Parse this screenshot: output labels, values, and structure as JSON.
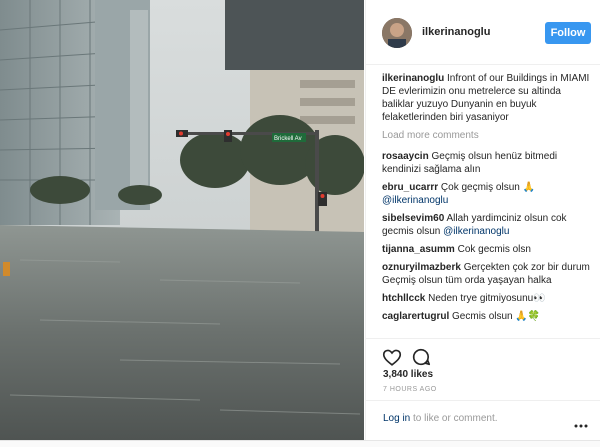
{
  "post": {
    "username": "ilkerinanoglu",
    "follow_label": "Follow",
    "caption": "Infront of our Buildings in MIAMI DE evlerimizin onu metrelerce su altinda baliklar yuzuyo Dunyanin en buyuk felaketlerinden biri yasaniyor",
    "load_more_label": "Load more comments",
    "likes": "3,840 likes",
    "timestamp": "7 HOURS AGO",
    "login_link": "Log in",
    "login_suffix": " to like or comment."
  },
  "comments": [
    {
      "user": "rosaaycin",
      "text": "Geçmiş olsun henüz bitmedi kendinizi sağlama alın"
    },
    {
      "user": "ebru_ucarrr",
      "text": "Çok geçmiş olsun 🙏",
      "mention": "@ilkerinanoglu"
    },
    {
      "user": "sibelsevim60",
      "text": "Allah yardimciniz olsun cok gecmis olsun",
      "mention": "@ilkerinanoglu"
    },
    {
      "user": "tijanna_asumm",
      "text": "Cok gecmis olsn"
    },
    {
      "user": "oznuryilmazberk",
      "text": "Gerçekten çok zor bir durum Geçmiş olsun tüm orda yaşayan halka"
    },
    {
      "user": "htchllcck",
      "text": "Neden trye gitmiyosunu👀"
    },
    {
      "user": "caglarertugrul",
      "text": "Gecmis olsun 🙏🍀"
    }
  ],
  "photo": {
    "street_sign": "Brickell Av"
  },
  "colors": {
    "follow_bg": "#3897f0",
    "mention": "#003569",
    "muted": "#999999"
  },
  "icons": [
    "heart-icon",
    "comment-icon",
    "more-options-icon"
  ]
}
